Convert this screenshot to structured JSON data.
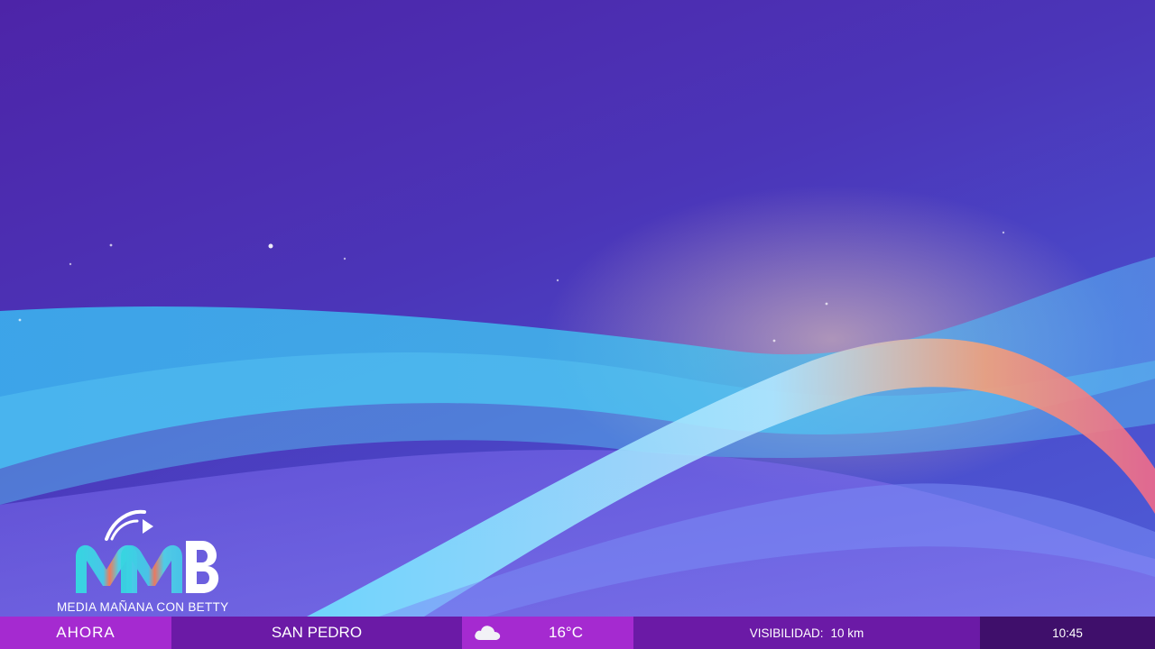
{
  "logo": {
    "monogram": "MMB",
    "tagline": "MEDIA MAÑANA CON BETTY"
  },
  "ticker": {
    "label_now": "AHORA",
    "location": "SAN PEDRO",
    "weather_icon": "cloud-icon",
    "temperature": "16°C",
    "visibility_label": "VISIBILIDAD:",
    "visibility_value": "10 km",
    "time": "10:45"
  },
  "colors": {
    "ticker_bright": "#a52ad0",
    "ticker_mid": "#6b1aa6",
    "ticker_dark": "#3f0f6b",
    "background_top": "#4d24a8",
    "wave_cyan": "#3fc8f0",
    "wave_pink": "#f27a86"
  }
}
